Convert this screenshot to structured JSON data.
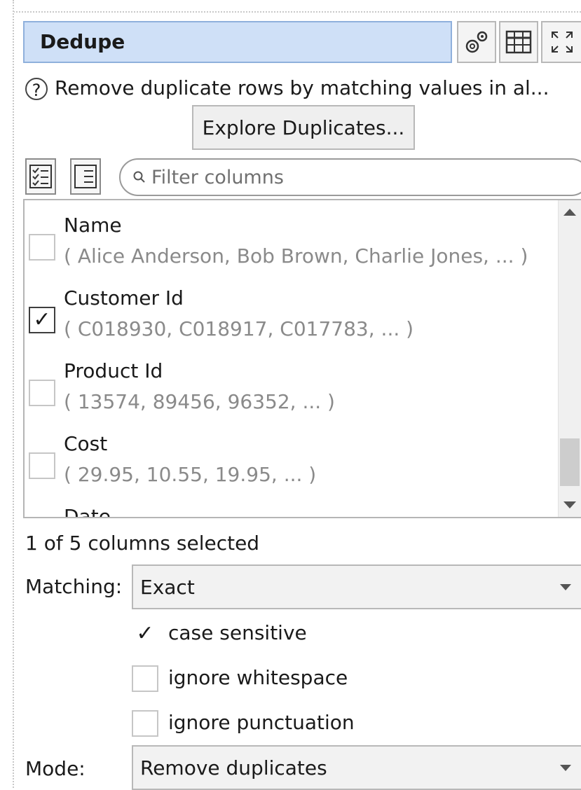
{
  "panel": {
    "title": "Dedupe",
    "tools": {
      "settings_icon": "gears-icon",
      "table_icon": "table-icon",
      "expand_icon": "expand-icon"
    },
    "help_icon_glyph": "?",
    "description": "Remove duplicate rows by matching values in al...",
    "explore_button": "Explore Duplicates...",
    "filter": {
      "placeholder": "Filter columns",
      "check_all_icon": "checklist-icon",
      "uncheck_all_icon": "list-icon"
    },
    "columns": [
      {
        "name": "Name",
        "sample": "( Alice Anderson, Bob Brown, Charlie Jones, ... )",
        "checked": false
      },
      {
        "name": "Customer Id",
        "sample": "( C018930, C018917, C017783, ... )",
        "checked": true
      },
      {
        "name": "Product Id",
        "sample": "( 13574, 89456, 96352, ... )",
        "checked": false
      },
      {
        "name": "Cost",
        "sample": "( 29.95, 10.55, 19.95, ... )",
        "checked": false
      },
      {
        "name": "Date",
        "sample": "",
        "checked": false
      }
    ],
    "status": "1 of 5 columns selected",
    "matching": {
      "label": "Matching:",
      "value": "Exact"
    },
    "options": [
      {
        "label": "case sensitive",
        "checked": true
      },
      {
        "label": "ignore whitespace",
        "checked": false
      },
      {
        "label": "ignore punctuation",
        "checked": false
      }
    ],
    "mode": {
      "label": "Mode:",
      "value": "Remove duplicates"
    },
    "check_glyph": "✓"
  }
}
